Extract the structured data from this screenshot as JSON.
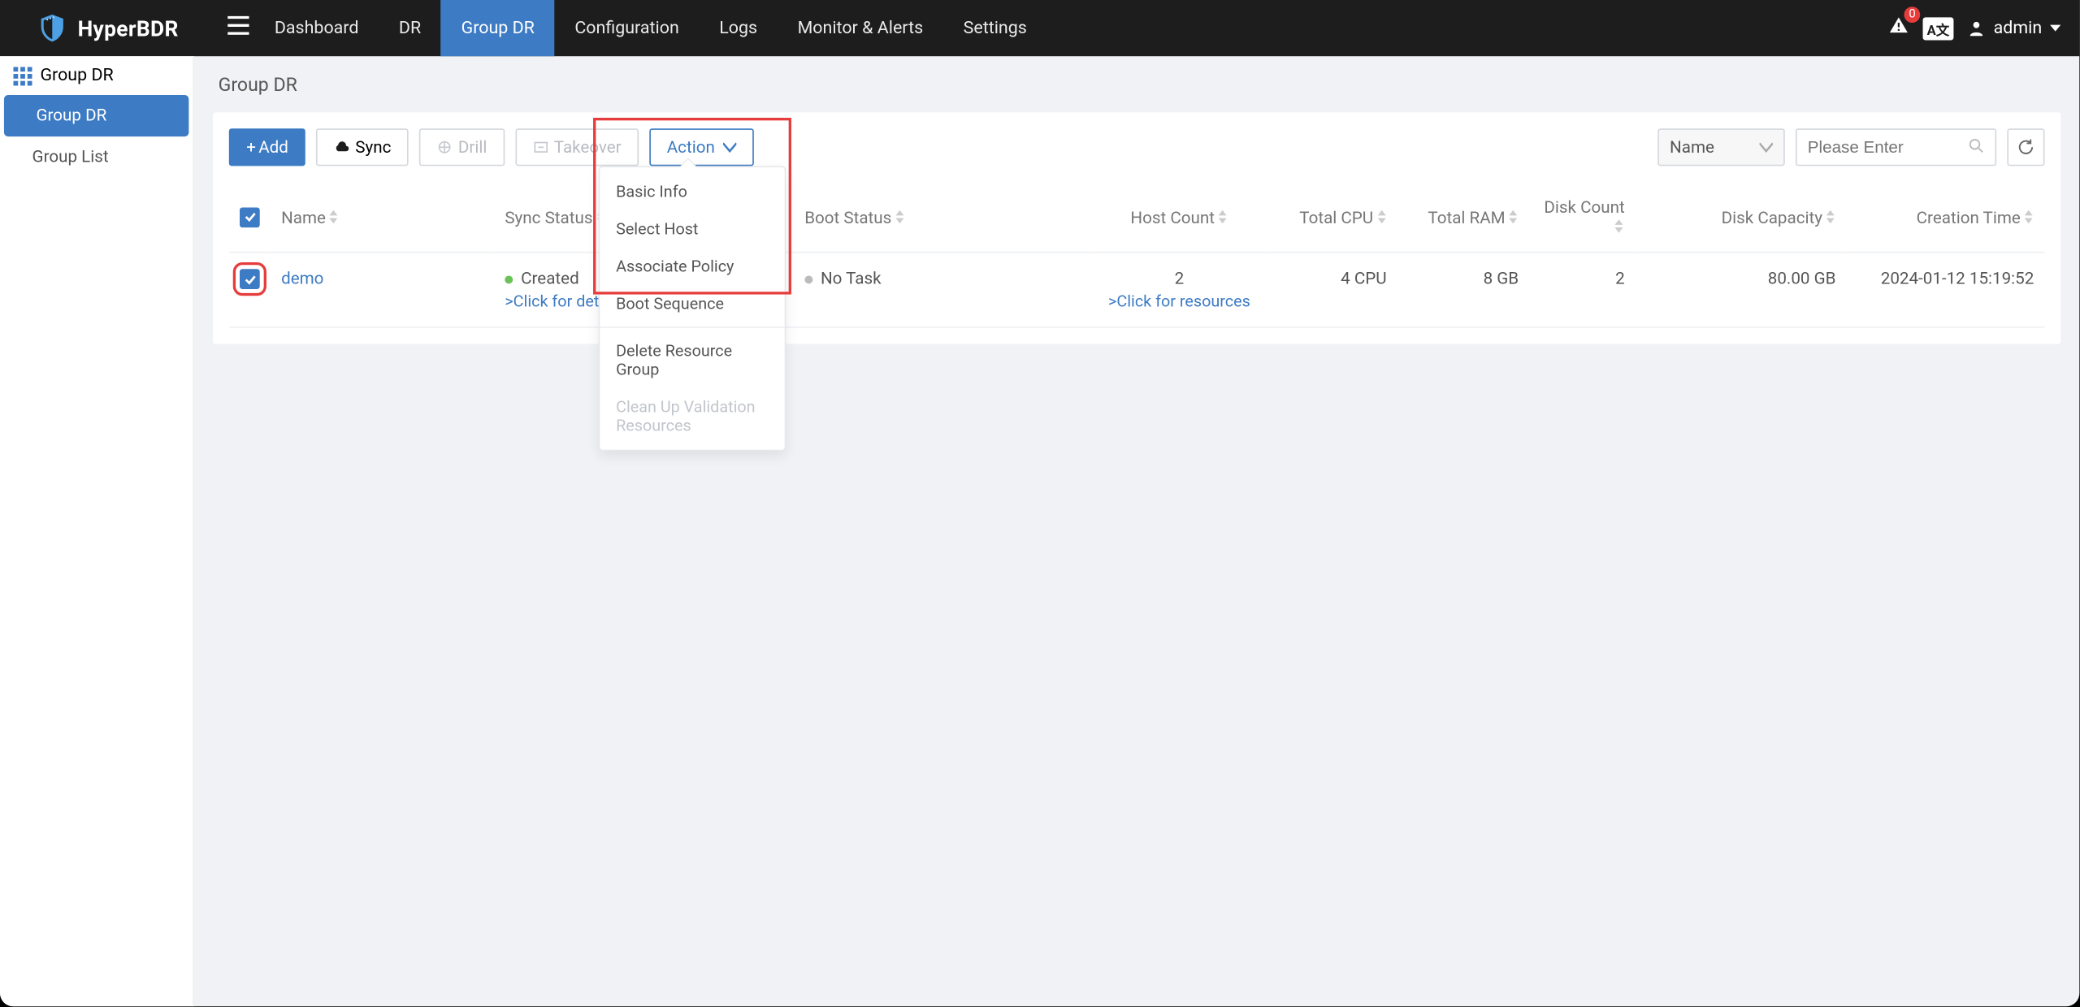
{
  "brand": "HyperBDR",
  "topnav": [
    "Dashboard",
    "DR",
    "Group DR",
    "Configuration",
    "Logs",
    "Monitor & Alerts",
    "Settings"
  ],
  "topnav_active": 2,
  "alert_count": "0",
  "lang_label": "A文",
  "username": "admin",
  "sidebar": {
    "title": "Group DR",
    "items": [
      "Group DR",
      "Group List"
    ],
    "active": 0
  },
  "page_title": "Group DR",
  "toolbar": {
    "add": "Add",
    "sync": "Sync",
    "drill": "Drill",
    "takeover": "Takeover",
    "action": "Action"
  },
  "search": {
    "select_label": "Name",
    "placeholder": "Please Enter"
  },
  "columns": {
    "name": "Name",
    "sync_status": "Sync Status",
    "boot_status": "Boot Status",
    "host_count": "Host Count",
    "total_cpu": "Total CPU",
    "total_ram": "Total RAM",
    "disk_count": "Disk Count",
    "disk_capacity": "Disk Capacity",
    "creation_time": "Creation Time"
  },
  "row": {
    "name": "demo",
    "sync_status": "Created",
    "sync_sub": ">Click for details",
    "boot_status": "No Task",
    "host_count": "2",
    "host_sub": ">Click for resources",
    "total_cpu": "4 CPU",
    "total_ram": "8 GB",
    "disk_count": "2",
    "disk_capacity": "80.00 GB",
    "creation_time": "2024-01-12 15:19:52"
  },
  "action_menu": {
    "basic_info": "Basic Info",
    "select_host": "Select Host",
    "associate_policy": "Associate Policy",
    "boot_sequence": "Boot Sequence",
    "delete_group": "Delete Resource Group",
    "cleanup": "Clean Up Validation Resources"
  }
}
